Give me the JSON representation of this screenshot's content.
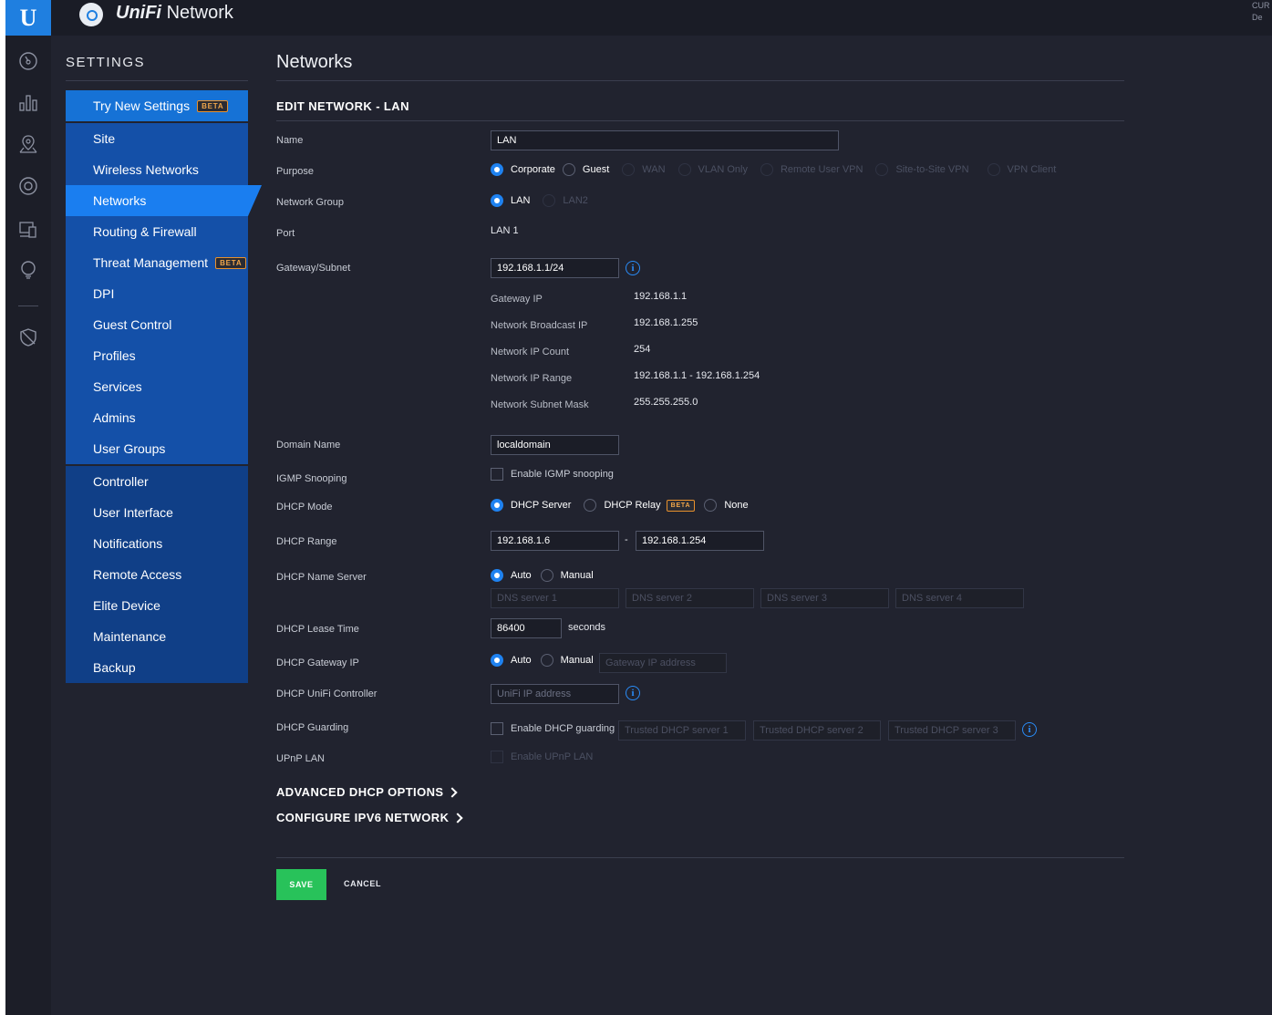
{
  "topbar": {
    "logo_letter": "U",
    "title_brand": "UniFi",
    "title_product": "Network",
    "right_text_1": "CUR",
    "right_text_2": "De"
  },
  "rail_icons": [
    "dashboard-icon",
    "statistics-icon",
    "map-icon",
    "devices-icon",
    "clients-icon",
    "insights-icon",
    "shield-icon"
  ],
  "settings": {
    "title": "SETTINGS",
    "try_new": {
      "label": "Try New Settings",
      "badge": "BETA"
    },
    "group1": [
      {
        "label": "Site"
      },
      {
        "label": "Wireless Networks"
      },
      {
        "label": "Networks",
        "active": true
      },
      {
        "label": "Routing & Firewall"
      },
      {
        "label": "Threat Management",
        "badge": "BETA"
      },
      {
        "label": "DPI"
      },
      {
        "label": "Guest Control"
      },
      {
        "label": "Profiles"
      },
      {
        "label": "Services"
      },
      {
        "label": "Admins"
      },
      {
        "label": "User Groups"
      }
    ],
    "group2": [
      {
        "label": "Controller"
      },
      {
        "label": "User Interface"
      },
      {
        "label": "Notifications"
      },
      {
        "label": "Remote Access"
      },
      {
        "label": "Elite Device"
      },
      {
        "label": "Maintenance"
      },
      {
        "label": "Backup"
      }
    ]
  },
  "page": {
    "title": "Networks",
    "section_title": "EDIT NETWORK - LAN"
  },
  "form": {
    "name": {
      "label": "Name",
      "value": "LAN"
    },
    "purpose": {
      "label": "Purpose",
      "options": [
        "Corporate",
        "Guest",
        "WAN",
        "VLAN Only",
        "Remote User VPN",
        "Site-to-Site VPN",
        "VPN Client"
      ],
      "selected": "Corporate"
    },
    "network_group": {
      "label": "Network Group",
      "options": [
        "LAN",
        "LAN2"
      ],
      "selected": "LAN"
    },
    "port": {
      "label": "Port",
      "value": "LAN 1"
    },
    "gateway_subnet": {
      "label": "Gateway/Subnet",
      "value": "192.168.1.1/24",
      "info_icon": "i"
    },
    "subnet_info": [
      {
        "label": "Gateway IP",
        "value": "192.168.1.1"
      },
      {
        "label": "Network Broadcast IP",
        "value": "192.168.1.255"
      },
      {
        "label": "Network IP Count",
        "value": "254"
      },
      {
        "label": "Network IP Range",
        "value": "192.168.1.1 - 192.168.1.254"
      },
      {
        "label": "Network Subnet Mask",
        "value": "255.255.255.0"
      }
    ],
    "domain_name": {
      "label": "Domain Name",
      "value": "localdomain"
    },
    "igmp": {
      "label": "IGMP Snooping",
      "checkbox_label": "Enable IGMP snooping",
      "checked": false
    },
    "dhcp_mode": {
      "label": "DHCP Mode",
      "options": [
        "DHCP Server",
        "DHCP Relay",
        "None"
      ],
      "selected": "DHCP Server",
      "relay_badge": "BETA"
    },
    "dhcp_range": {
      "label": "DHCP Range",
      "start": "192.168.1.6",
      "separator": "-",
      "end": "192.168.1.254"
    },
    "dhcp_name_server": {
      "label": "DHCP Name Server",
      "options": [
        "Auto",
        "Manual"
      ],
      "selected": "Auto",
      "placeholders": [
        "DNS server 1",
        "DNS server 2",
        "DNS server 3",
        "DNS server 4"
      ]
    },
    "dhcp_lease": {
      "label": "DHCP Lease Time",
      "value": "86400",
      "unit": "seconds"
    },
    "dhcp_gateway": {
      "label": "DHCP Gateway IP",
      "options": [
        "Auto",
        "Manual"
      ],
      "selected": "Auto",
      "placeholder": "Gateway IP address"
    },
    "dhcp_unifi_controller": {
      "label": "DHCP UniFi Controller",
      "placeholder": "UniFi IP address",
      "info_icon": "i"
    },
    "dhcp_guarding": {
      "label": "DHCP Guarding",
      "checkbox_label": "Enable DHCP guarding",
      "checked": false,
      "placeholders": [
        "Trusted DHCP server 1",
        "Trusted DHCP server 2",
        "Trusted DHCP server 3"
      ],
      "info_icon": "i"
    },
    "upnp": {
      "label": "UPnP LAN",
      "checkbox_label": "Enable UPnP LAN",
      "checked": false
    }
  },
  "advanced": {
    "dhcp_options": "ADVANCED DHCP OPTIONS",
    "ipv6": "CONFIGURE IPV6 NETWORK"
  },
  "actions": {
    "save": "SAVE",
    "cancel": "CANCEL"
  },
  "colors": {
    "accent": "#1f82f0",
    "menu_active": "#1a7ef0",
    "save_green": "#28c25a",
    "beta_orange": "#e8912d"
  }
}
